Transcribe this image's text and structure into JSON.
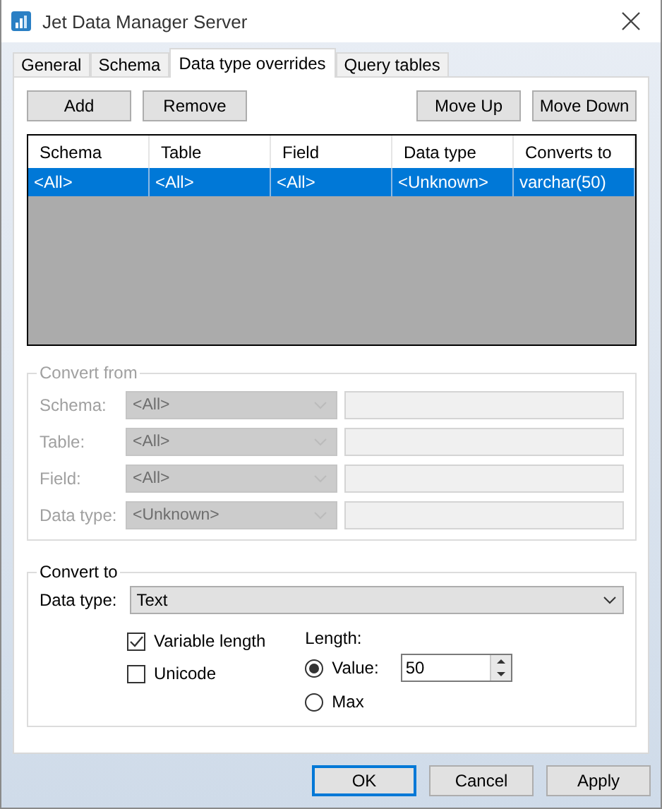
{
  "window": {
    "title": "Jet Data Manager Server"
  },
  "tabs": [
    {
      "label": "General",
      "selected": false
    },
    {
      "label": "Schema",
      "selected": false
    },
    {
      "label": "Data type overrides",
      "selected": true
    },
    {
      "label": "Query tables",
      "selected": false
    }
  ],
  "toolbar": {
    "left": [
      "Add",
      "Remove"
    ],
    "right": [
      "Move Up",
      "Move Down"
    ]
  },
  "grid": {
    "columns": [
      "Schema",
      "Table",
      "Field",
      "Data type",
      "Converts to"
    ],
    "rows": [
      {
        "cells": [
          "<All>",
          "<All>",
          "<All>",
          "<Unknown>",
          "varchar(50)"
        ],
        "selected": true
      }
    ]
  },
  "convert_from": {
    "title": "Convert from",
    "disabled": true,
    "rows": [
      {
        "label": "Schema:",
        "value": "<All>"
      },
      {
        "label": "Table:",
        "value": "<All>"
      },
      {
        "label": "Field:",
        "value": "<All>"
      },
      {
        "label": "Data type:",
        "value": "<Unknown>"
      }
    ]
  },
  "convert_to": {
    "title": "Convert to",
    "data_type": {
      "label": "Data type:",
      "value": "Text"
    },
    "checkboxes": [
      {
        "label": "Variable length",
        "checked": true
      },
      {
        "label": "Unicode",
        "checked": false
      }
    ],
    "length": {
      "label": "Length:",
      "value": "50",
      "options": [
        {
          "label": "Value:",
          "selected": true
        },
        {
          "label": "Max",
          "selected": false
        }
      ]
    }
  },
  "buttons": [
    {
      "label": "OK",
      "default": true
    },
    {
      "label": "Cancel",
      "default": false
    },
    {
      "label": "Apply",
      "default": false
    }
  ]
}
